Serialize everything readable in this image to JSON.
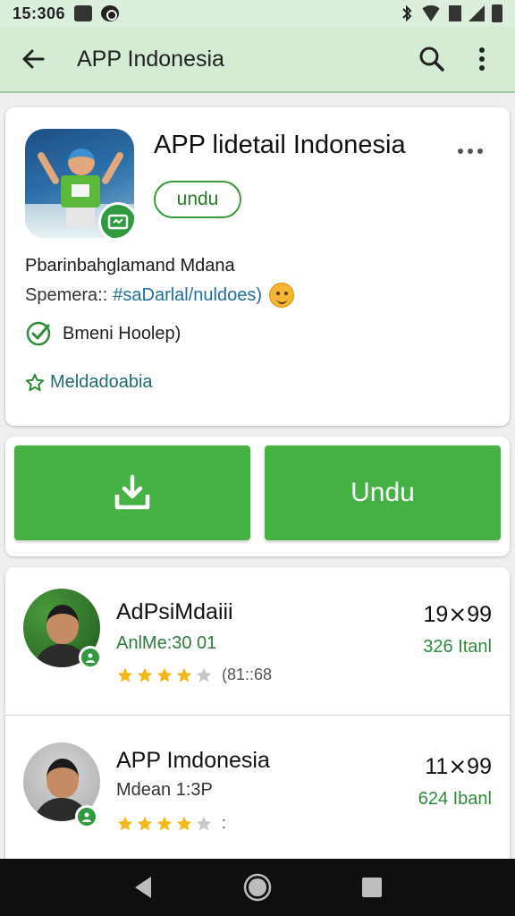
{
  "status_bar": {
    "time": "15:306",
    "icons": [
      "image-icon",
      "circle-notification-icon",
      "bluetooth-icon",
      "wifi-icon",
      "sim-icon",
      "signal-icon",
      "battery-icon"
    ]
  },
  "app_bar": {
    "title": "APP Indonesia",
    "back_icon": "arrow-left-icon",
    "search_icon": "search-icon",
    "more_icon": "more-vert-icon"
  },
  "detail": {
    "title": "APP lidetail Indonesia",
    "pill_label": "undu",
    "desc_line1": "Pbarinbahglamand Mdana",
    "desc_prefix": "Spemera::",
    "desc_hashtag": "#saDarlal/nuldoes)",
    "verified_text": "Bmeni Hoolep)",
    "link_text": "Meldadoabia"
  },
  "buttons": {
    "right_label": "Undu"
  },
  "list": [
    {
      "name": "AdPsiMdaiii",
      "sub": "AnlMe:30 01",
      "rating_stars": 4,
      "rating_count": "(81::68",
      "price": "19⨯99",
      "size": "326 Itanl"
    },
    {
      "name": "APP Imdonesia",
      "sub": "Mdean 1:3P",
      "rating_stars": 4,
      "rating_count": ":",
      "price": "11⨯99",
      "size": "624 Ibanl"
    }
  ],
  "colors": {
    "accent_green": "#46b246",
    "app_bar_bg": "#d4ecd4",
    "status_bar_bg": "#dcefdc",
    "star_gold": "#f2b81c"
  }
}
